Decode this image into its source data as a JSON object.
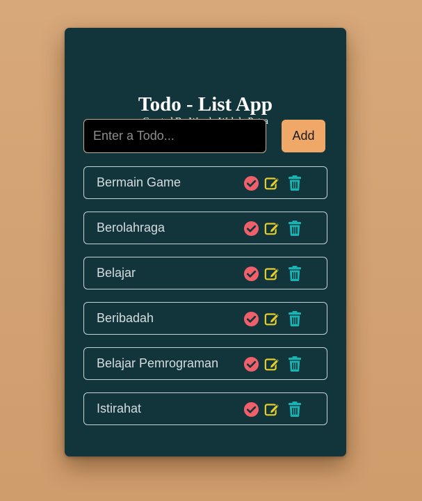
{
  "app": {
    "title": "Todo - List App",
    "subtitle": "Created By Wendy Wahda Putra"
  },
  "form": {
    "input_placeholder": "Enter a Todo...",
    "input_value": "",
    "add_label": "Add"
  },
  "todos": [
    {
      "text": "Bermain Game"
    },
    {
      "text": "Berolahraga"
    },
    {
      "text": "Belajar"
    },
    {
      "text": "Beribadah"
    },
    {
      "text": "Belajar Pemrograman"
    },
    {
      "text": "Istirahat"
    }
  ],
  "icons": {
    "complete": "check-circle-icon",
    "edit": "edit-icon",
    "delete": "trash-icon"
  },
  "colors": {
    "background": "#d5a577",
    "card": "#12343b",
    "accent": "#f0a868",
    "complete": "#f0606a",
    "edit": "#e6cf2a",
    "delete": "#1ab3b3"
  }
}
